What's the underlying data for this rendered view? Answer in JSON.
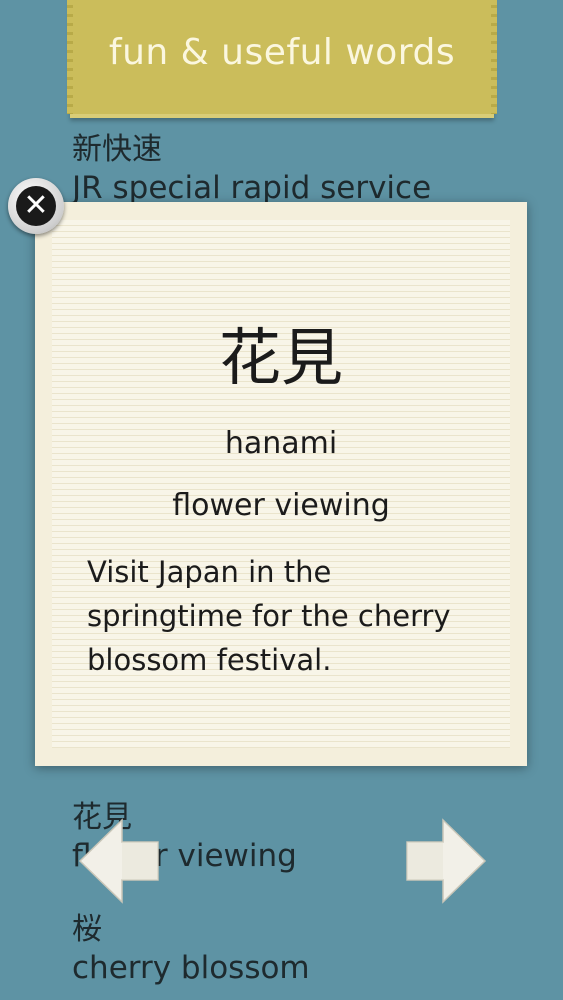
{
  "header": {
    "title": "fun & useful words"
  },
  "list": [
    {
      "kanji": "新快速",
      "meaning": "JR special rapid service"
    },
    {
      "kanji": "",
      "meaning": ""
    },
    {
      "kanji": "花見",
      "meaning": "flower viewing"
    },
    {
      "kanji": "桜",
      "meaning": "cherry blossom"
    }
  ],
  "card": {
    "kanji": "花見",
    "romaji": "hanami",
    "english": "flower viewing",
    "example": "Visit Japan in the springtime for the cherry blossom festival."
  },
  "icons": {
    "close": "close-icon",
    "prev": "arrow-left-icon",
    "next": "arrow-right-icon"
  },
  "colors": {
    "background": "#5e93a4",
    "banner": "#cbbd5b",
    "card": "#f4efdc"
  }
}
